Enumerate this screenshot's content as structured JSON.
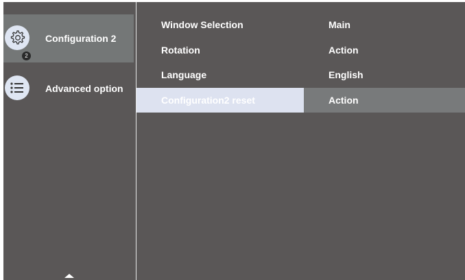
{
  "sidebar": {
    "items": [
      {
        "label": "Configuration 2",
        "icon": "settings-gear-icon",
        "badge": "2",
        "active": true
      },
      {
        "label": "Advanced option",
        "icon": "list-icon",
        "active": false
      }
    ]
  },
  "menu": {
    "rows": [
      {
        "label": "Window Selection",
        "value": "Main"
      },
      {
        "label": "Rotation",
        "value": "Action"
      },
      {
        "label": "Language",
        "value": "English"
      },
      {
        "label": "Configuration2 reset",
        "value": "Action",
        "selected": true
      }
    ]
  },
  "colors": {
    "panel_bg": "#5a5757",
    "sidebar_active": "#747777",
    "selected_label_bg": "#dde2f0",
    "selected_value_bg": "#787a7b",
    "icon_circle": "#dfe6f3"
  },
  "nav": {
    "scroll_up_icon": "chevron-up-icon"
  }
}
